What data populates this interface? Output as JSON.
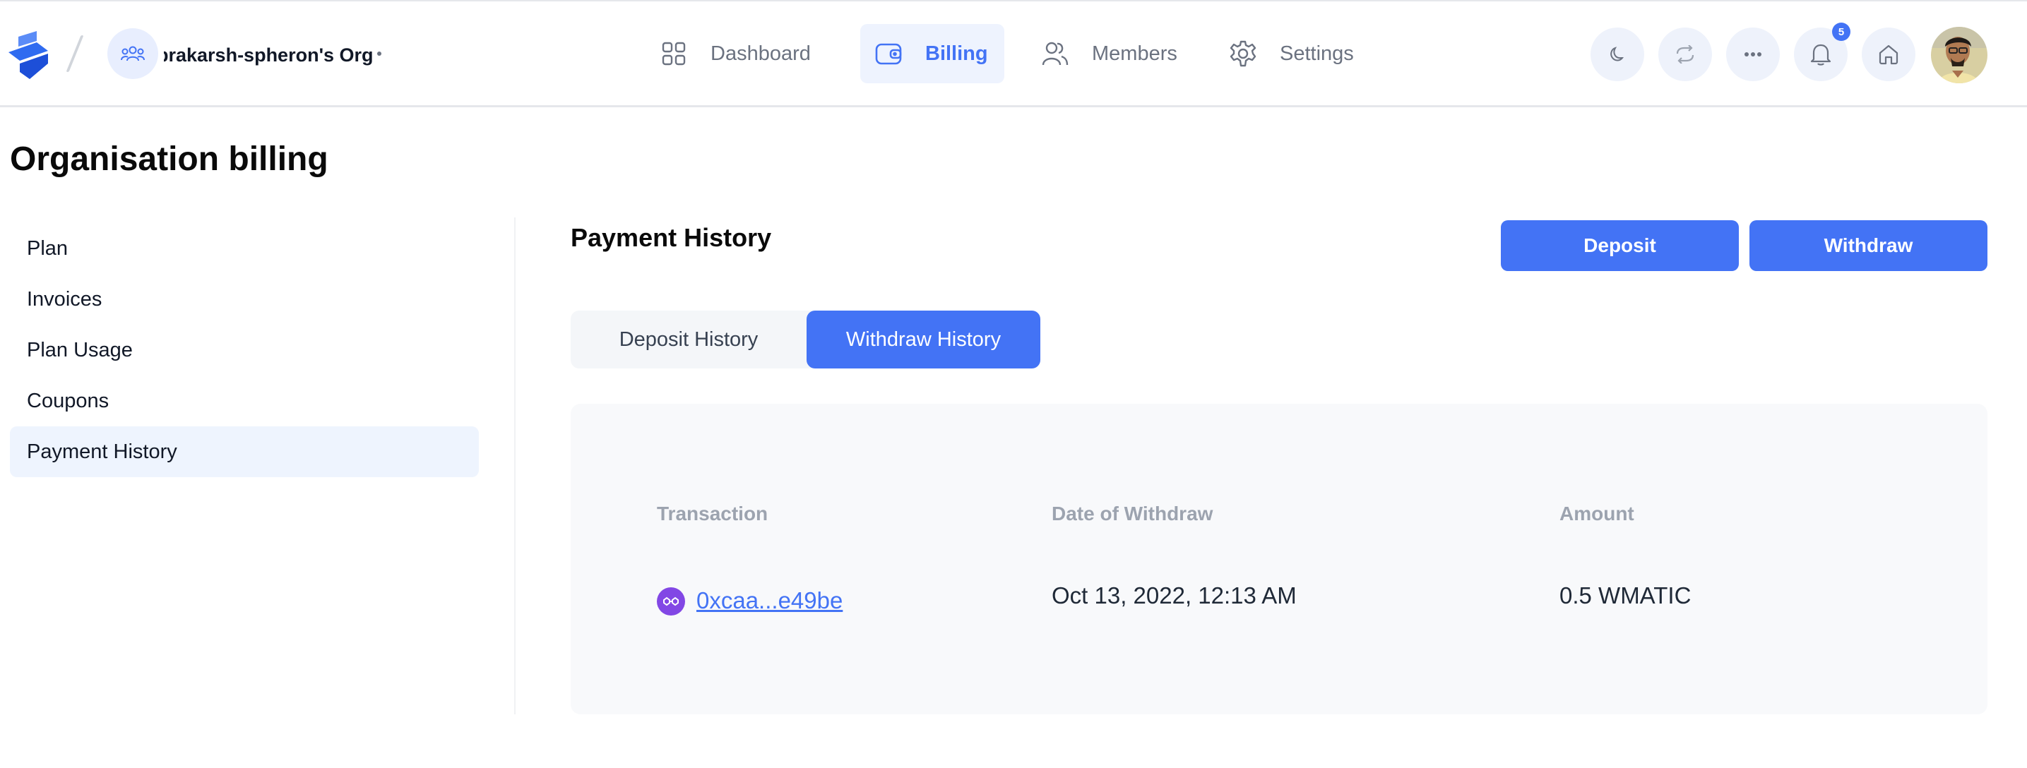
{
  "header": {
    "org_name": "prakarsh-spheron's Org",
    "nav": [
      {
        "label": "Dashboard",
        "icon": "grid-icon"
      },
      {
        "label": "Billing",
        "icon": "wallet-icon"
      },
      {
        "label": "Members",
        "icon": "users-icon"
      },
      {
        "label": "Settings",
        "icon": "gear-icon"
      }
    ],
    "active_nav": "Billing",
    "notification_count": "5",
    "accent_color": "#4373f5"
  },
  "page": {
    "title": "Organisation billing"
  },
  "sidebar": {
    "items": [
      {
        "label": "Plan"
      },
      {
        "label": "Invoices"
      },
      {
        "label": "Plan Usage"
      },
      {
        "label": "Coupons"
      },
      {
        "label": "Payment History"
      }
    ],
    "active": "Payment History"
  },
  "main": {
    "section_title": "Payment History",
    "deposit_label": "Deposit",
    "withdraw_label": "Withdraw",
    "tabs": [
      {
        "label": "Deposit History"
      },
      {
        "label": "Withdraw History"
      }
    ],
    "active_tab": "Withdraw History",
    "table": {
      "columns": [
        "Transaction",
        "Date of Withdraw",
        "Amount"
      ],
      "rows": [
        {
          "transaction": "0xcaa...e49be",
          "date": "Oct 13, 2022, 12:13 AM",
          "amount": "0.5 WMATIC",
          "token_icon": "polygon-icon"
        }
      ]
    }
  }
}
